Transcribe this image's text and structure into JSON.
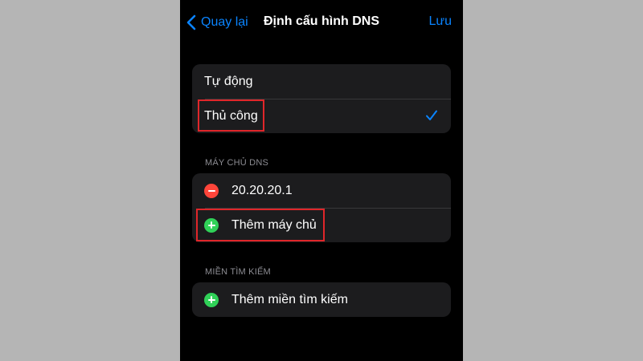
{
  "nav": {
    "back_label": "Quay lại",
    "title": "Định cấu hình DNS",
    "save_label": "Lưu"
  },
  "config_mode": {
    "options": [
      {
        "label": "Tự động",
        "selected": false
      },
      {
        "label": "Thủ công",
        "selected": true
      }
    ]
  },
  "dns_servers": {
    "header": "MÁY CHỦ DNS",
    "servers": [
      "20.20.20.1"
    ],
    "add_label": "Thêm máy chủ"
  },
  "search_domains": {
    "header": "MIỀN TÌM KIẾM",
    "add_label": "Thêm miền tìm kiếm"
  },
  "colors": {
    "accent": "#0a84ff",
    "remove": "#ff453a",
    "add": "#30d158",
    "highlight": "#e0262a"
  },
  "icons": [
    "chevron-left-icon",
    "checkmark-icon",
    "remove-circle-icon",
    "add-circle-icon"
  ]
}
